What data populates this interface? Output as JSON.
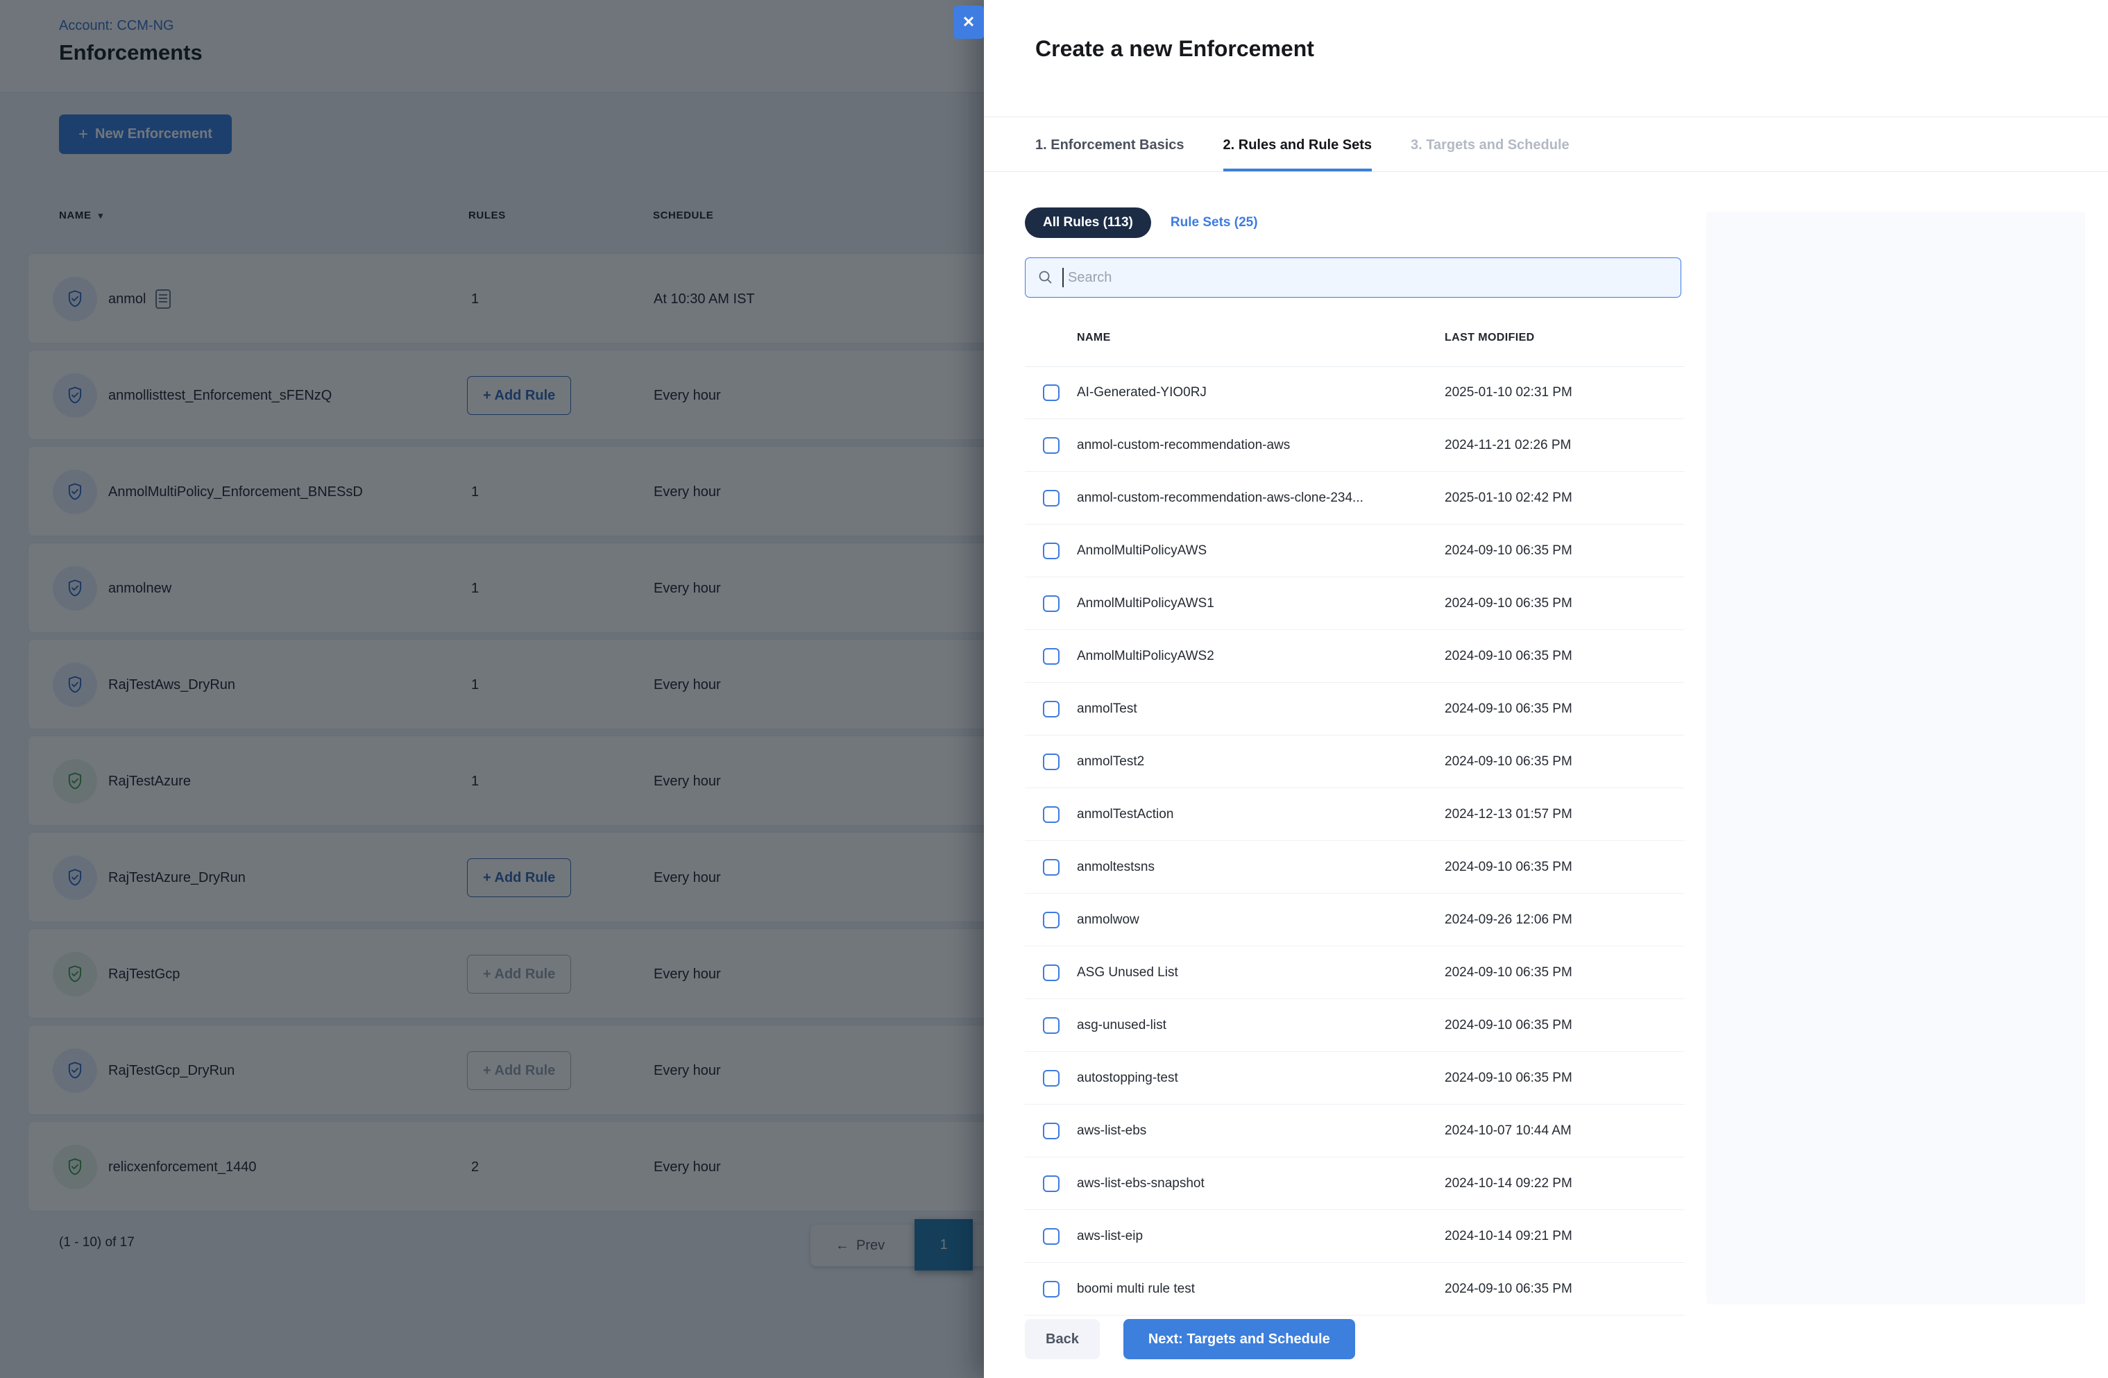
{
  "colors": {
    "accent_blue": "#3d7fdc",
    "navy_pill": "#1d2c45",
    "shield_blue": "#3568c9",
    "shield_green": "#3f9e53",
    "search_border": "#3e7be0",
    "pagination_active": "#2b7db0",
    "overlay": "rgba(4,12,22,0.56)"
  },
  "icons": {
    "plus": "+",
    "sort_caret": "▾",
    "prev_arrow": "←",
    "close": "✕"
  },
  "page": {
    "account_breadcrumb": "Account: CCM-NG",
    "title": "Enforcements",
    "new_enforcement_label": "New Enforcement",
    "table": {
      "columns": {
        "name": "NAME",
        "rules": "RULES",
        "schedule": "SCHEDULE"
      },
      "add_rule_label": "+ Add Rule",
      "rows": [
        {
          "name": "anmol",
          "icon": "shield-check-blue",
          "doc_icon": true,
          "rules": "1",
          "add_rule": null,
          "schedule": "At 10:30 AM IST"
        },
        {
          "name": "anmollisttest_Enforcement_sFENzQ",
          "icon": "shield-check-blue",
          "doc_icon": false,
          "rules": null,
          "add_rule": "enabled",
          "schedule": "Every hour"
        },
        {
          "name": "AnmolMultiPolicy_Enforcement_BNESsD",
          "icon": "shield-check-blue",
          "doc_icon": false,
          "rules": "1",
          "add_rule": null,
          "schedule": "Every hour"
        },
        {
          "name": "anmolnew",
          "icon": "shield-check-blue",
          "doc_icon": false,
          "rules": "1",
          "add_rule": null,
          "schedule": "Every hour"
        },
        {
          "name": "RajTestAws_DryRun",
          "icon": "shield-check-blue",
          "doc_icon": false,
          "rules": "1",
          "add_rule": null,
          "schedule": "Every hour"
        },
        {
          "name": "RajTestAzure",
          "icon": "shield-check-green",
          "doc_icon": false,
          "rules": "1",
          "add_rule": null,
          "schedule": "Every hour"
        },
        {
          "name": "RajTestAzure_DryRun",
          "icon": "shield-check-blue",
          "doc_icon": false,
          "rules": null,
          "add_rule": "enabled",
          "schedule": "Every hour"
        },
        {
          "name": "RajTestGcp",
          "icon": "shield-check-green",
          "doc_icon": false,
          "rules": null,
          "add_rule": "disabled",
          "schedule": "Every hour"
        },
        {
          "name": "RajTestGcp_DryRun",
          "icon": "shield-check-blue",
          "doc_icon": false,
          "rules": null,
          "add_rule": "disabled",
          "schedule": "Every hour"
        },
        {
          "name": "relicxenforcement_1440",
          "icon": "shield-check-green",
          "doc_icon": false,
          "rules": "2",
          "add_rule": null,
          "schedule": "Every hour"
        }
      ]
    },
    "pagination": {
      "range_label": "(1 - 10) of 17",
      "prev_label": "Prev",
      "current_page": "1"
    }
  },
  "drawer": {
    "title": "Create a new Enforcement",
    "tabs": [
      {
        "label": "1. Enforcement Basics",
        "state": "done"
      },
      {
        "label": "2. Rules and Rule Sets",
        "state": "active"
      },
      {
        "label": "3. Targets and Schedule",
        "state": "upcoming"
      }
    ],
    "filters": {
      "all_rules_label": "All Rules (113)",
      "rule_sets_label": "Rule Sets (25)"
    },
    "search": {
      "placeholder": "Search",
      "value": ""
    },
    "rules": {
      "columns": {
        "name": "NAME",
        "last_modified": "LAST MODIFIED"
      },
      "rows": [
        {
          "name": "AI-Generated-YIO0RJ",
          "last_modified": "2025-01-10 02:31 PM"
        },
        {
          "name": "anmol-custom-recommendation-aws",
          "last_modified": "2024-11-21 02:26 PM"
        },
        {
          "name": "anmol-custom-recommendation-aws-clone-234...",
          "last_modified": "2025-01-10 02:42 PM"
        },
        {
          "name": "AnmolMultiPolicyAWS",
          "last_modified": "2024-09-10 06:35 PM"
        },
        {
          "name": "AnmolMultiPolicyAWS1",
          "last_modified": "2024-09-10 06:35 PM"
        },
        {
          "name": "AnmolMultiPolicyAWS2",
          "last_modified": "2024-09-10 06:35 PM"
        },
        {
          "name": "anmolTest",
          "last_modified": "2024-09-10 06:35 PM"
        },
        {
          "name": "anmolTest2",
          "last_modified": "2024-09-10 06:35 PM"
        },
        {
          "name": "anmolTestAction",
          "last_modified": "2024-12-13 01:57 PM"
        },
        {
          "name": "anmoltestsns",
          "last_modified": "2024-09-10 06:35 PM"
        },
        {
          "name": "anmolwow",
          "last_modified": "2024-09-26 12:06 PM"
        },
        {
          "name": "ASG Unused List",
          "last_modified": "2024-09-10 06:35 PM"
        },
        {
          "name": "asg-unused-list",
          "last_modified": "2024-09-10 06:35 PM"
        },
        {
          "name": "autostopping-test",
          "last_modified": "2024-09-10 06:35 PM"
        },
        {
          "name": "aws-list-ebs",
          "last_modified": "2024-10-07 10:44 AM"
        },
        {
          "name": "aws-list-ebs-snapshot",
          "last_modified": "2024-10-14 09:22 PM"
        },
        {
          "name": "aws-list-eip",
          "last_modified": "2024-10-14 09:21 PM"
        },
        {
          "name": "boomi multi rule test",
          "last_modified": "2024-09-10 06:35 PM"
        }
      ]
    },
    "footer": {
      "back_label": "Back",
      "next_label": "Next: Targets and Schedule"
    }
  }
}
